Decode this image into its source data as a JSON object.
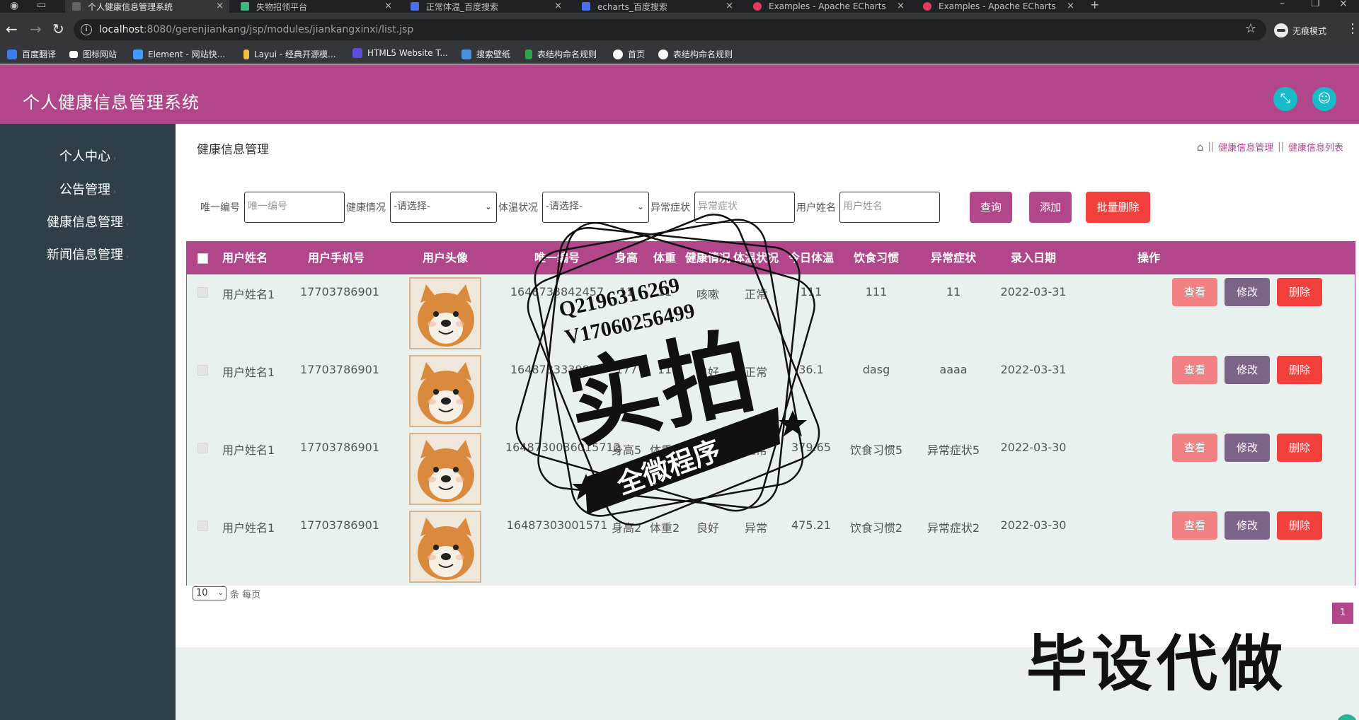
{
  "browser": {
    "tabs": [
      {
        "title": "个人健康信息管理系统",
        "active": true
      },
      {
        "title": "失物招领平台",
        "active": false
      },
      {
        "title": "正常体温_百度搜索",
        "active": false
      },
      {
        "title": "echarts_百度搜索",
        "active": false
      },
      {
        "title": "Examples - Apache ECharts",
        "active": false
      },
      {
        "title": "Examples - Apache ECharts",
        "active": false
      }
    ],
    "url_host": "localhost",
    "url_rest": ":8080/gerenjiankang/jsp/modules/jiankangxinxi/list.jsp",
    "incognito_label": "无痕模式",
    "bookmarks": [
      {
        "label": "百度翻译",
        "color": "#3b7ded"
      },
      {
        "label": "图标网站",
        "color": "#ffffff"
      },
      {
        "label": "Element - 网站快...",
        "color": "#409eff"
      },
      {
        "label": "Layui - 经典开源模...",
        "color": "#f0c040"
      },
      {
        "label": "HTML5 Website T...",
        "color": "#5b4fd8"
      },
      {
        "label": "搜索壁纸",
        "color": "#4a90e2"
      },
      {
        "label": "表结构命名规则",
        "color": "#2ea44f"
      },
      {
        "label": "首页",
        "color": "#ffffff"
      },
      {
        "label": "表结构命名规则",
        "color": "#ffffff"
      }
    ]
  },
  "app": {
    "title": "个人健康信息管理系统",
    "accent": "#b2468a",
    "sidebar": [
      {
        "label": "个人中心"
      },
      {
        "label": "公告管理"
      },
      {
        "label": "健康信息管理"
      },
      {
        "label": "新闻信息管理"
      }
    ],
    "page_title": "健康信息管理",
    "breadcrumb": [
      "健康信息管理",
      "健康信息列表"
    ],
    "filters": {
      "id_label": "唯一编号",
      "id_placeholder": "唯一编号",
      "health_label": "健康情况",
      "health_value": "-请选择-",
      "temp_label": "体温状况",
      "temp_value": "-请选择-",
      "symptom_label": "异常症状",
      "symptom_placeholder": "异常症状",
      "name_label": "用户姓名",
      "name_placeholder": "用户姓名"
    },
    "buttons": {
      "query": "查询",
      "add": "添加",
      "batch_delete": "批量删除"
    },
    "table": {
      "columns": [
        "用户姓名",
        "用户手机号",
        "用户头像",
        "唯一编号",
        "身高",
        "体重",
        "健康情况",
        "体温状况",
        "今日体温",
        "饮食习惯",
        "异常症状",
        "录入日期",
        "操作"
      ],
      "rows": [
        {
          "name": "用户姓名1",
          "phone": "17703786901",
          "id": "1648733842457",
          "height": "11",
          "weight": "11",
          "health": "咳嗽",
          "temp_status": "正常",
          "temp": "111",
          "diet": "111",
          "symptom": "11",
          "date": "2022-03-31"
        },
        {
          "name": "用户姓名1",
          "phone": "17703786901",
          "id": "1648733339827",
          "height": "177",
          "weight": "11",
          "health": "良好",
          "temp_status": "正常",
          "temp": "36.1",
          "diet": "dasg",
          "symptom": "aaaa",
          "date": "2022-03-31"
        },
        {
          "name": "用户姓名1",
          "phone": "17703786901",
          "id": "1648730036015712",
          "height": "身高5",
          "weight": "体重5",
          "health": "良好",
          "temp_status": "正常",
          "temp": "379.65",
          "diet": "饮食习惯5",
          "symptom": "异常症状5",
          "date": "2022-03-30"
        },
        {
          "name": "用户姓名1",
          "phone": "17703786901",
          "id": "16487303001571",
          "height": "身高2",
          "weight": "体重2",
          "health": "良好",
          "temp_status": "异常",
          "temp": "475.21",
          "diet": "饮食习惯2",
          "symptom": "异常症状2",
          "date": "2022-03-30"
        }
      ],
      "row_actions": {
        "view": "查看",
        "edit": "修改",
        "delete": "删除"
      }
    },
    "pager": {
      "page_size": "10",
      "per_page_label": "条 每页",
      "current_page": "1"
    }
  },
  "overlay": {
    "stamp_line1": "Q2196316269",
    "stamp_line2": "V17060256499",
    "stamp_big": "实拍",
    "stamp_banner": "全微程序",
    "bottom_text": "毕设代做"
  }
}
